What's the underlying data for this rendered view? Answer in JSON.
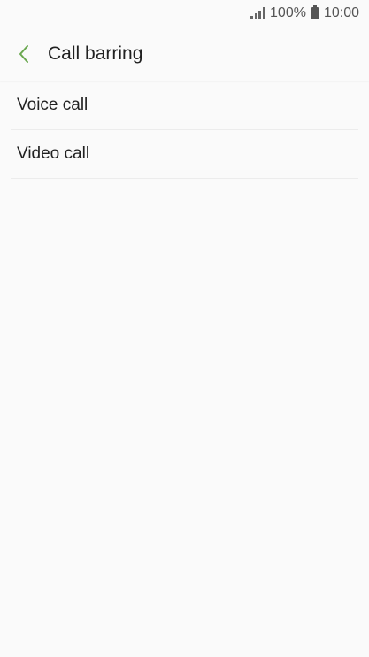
{
  "status_bar": {
    "battery_percent": "100%",
    "time": "10:00",
    "signal_icon": "signal-icon",
    "battery_icon": "battery-icon"
  },
  "header": {
    "back_icon": "chevron-left-icon",
    "title": "Call barring",
    "accent_color": "#6aa84f"
  },
  "list": {
    "items": [
      {
        "label": "Voice call"
      },
      {
        "label": "Video call"
      }
    ]
  }
}
